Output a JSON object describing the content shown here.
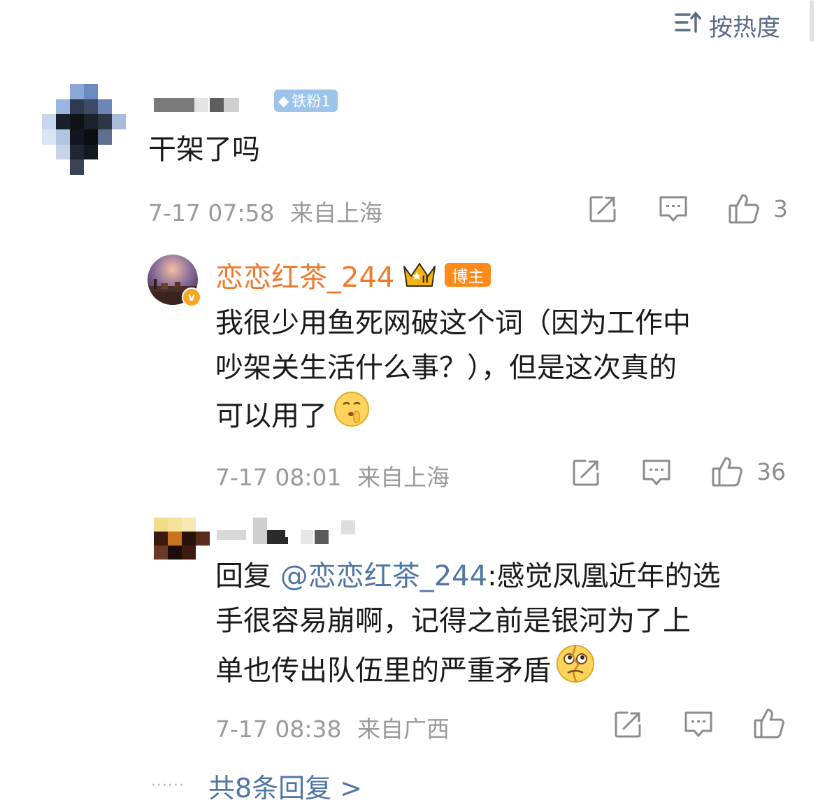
{
  "sort": {
    "label": "按热度",
    "icon": "sort-hot-icon"
  },
  "comment": {
    "author_badge": "铁粉1",
    "text": "干架了吗",
    "time": "7-17 07:58",
    "location": "来自上海",
    "likes": "3"
  },
  "replies": [
    {
      "author": "恋恋红茶_244",
      "host_badge": "博主",
      "crown_level": "II",
      "text_lines": [
        "我很少用鱼死网破这个词（因为工作中",
        "吵架关生活什么事？），但是这次真的",
        "可以用了"
      ],
      "emoji": "shush-emoji",
      "time": "7-17 08:01",
      "location": "来自上海",
      "likes": "36"
    },
    {
      "reply_prefix": "回复",
      "mention": "@恋恋红茶_244",
      "text_first": ":感觉凤凰近年的选",
      "text_lines": [
        "手很容易崩啊，记得之前是银河为了上",
        "单也传出队伍里的严重矛盾"
      ],
      "emoji": "broken-face-emoji",
      "time": "7-17 08:38",
      "location": "来自广西",
      "likes": ""
    }
  ],
  "more_replies": {
    "dots": "······",
    "label": "共8条回复 >"
  },
  "colors": {
    "accent_blue": "#4f76a5",
    "host_orange": "#f07a2c",
    "meta_grey": "#9a9a9a"
  }
}
